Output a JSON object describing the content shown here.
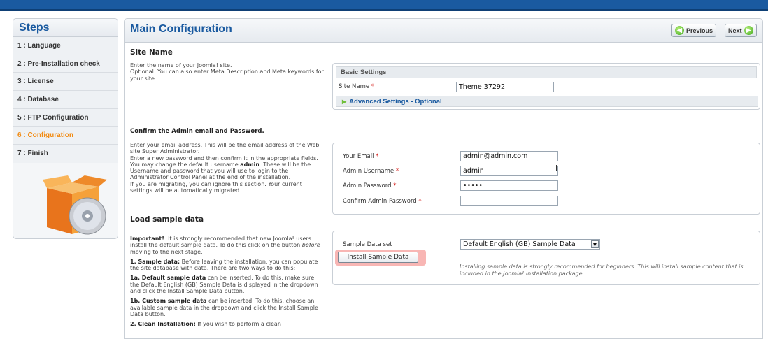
{
  "sidebar": {
    "title": "Steps",
    "steps": [
      {
        "label": "1 : Language"
      },
      {
        "label": "2 : Pre-Installation check"
      },
      {
        "label": "3 : License"
      },
      {
        "label": "4 : Database"
      },
      {
        "label": "5 : FTP Configuration"
      },
      {
        "label": "6 : Configuration"
      },
      {
        "label": "7 : Finish"
      }
    ]
  },
  "header": {
    "title": "Main Configuration",
    "previous_label": "Previous",
    "next_label": "Next"
  },
  "site_name": {
    "section_title": "Site Name",
    "desc_line1": "Enter the name of your Joomla! site.",
    "desc_line2": "Optional: You can also enter Meta Description and Meta keywords for your site.",
    "fieldset_title": "Basic Settings",
    "site_name_label": "Site Name",
    "site_name_value": "Theme 37292",
    "advanced_label": "Advanced Settings - Optional"
  },
  "admin": {
    "section_title": "Confirm the Admin email and Password.",
    "desc_a": "Enter your email address. This will be the email address of the Web site Super Administrator.",
    "desc_b": "Enter a new password and then confirm it in the appropriate fields. You may change the default username",
    "desc_b_bold": "admin",
    "desc_c": ". These will be the Username and password that you will use to login to the Administrator Control Panel at the end of the installation.",
    "desc_d": "If you are migrating, you can ignore this section. Your current settings will be automatically migrated.",
    "email_label": "Your Email",
    "email_value": "admin@admin.com",
    "username_label": "Admin Username",
    "username_value": "admin",
    "password_label": "Admin Password",
    "password_value": "•••••",
    "confirm_label": "Confirm Admin Password",
    "confirm_value": ""
  },
  "sample": {
    "section_title": "Load sample data",
    "important_bold": "Important!",
    "important_text": ": It is strongly recommended that new Joomla! users install the default sample data. To do this click on the button",
    "important_em": "before",
    "important_end": "moving to the next stage.",
    "p1_bold": "1. Sample data:",
    "p1_text": "Before leaving the installation, you can populate the site database with data. There are two ways to do this:",
    "p1a_bold": "1a. Default sample data",
    "p1a_text": "can be inserted. To do this, make sure the Default English (GB) Sample Data is displayed in the dropdown and click the Install Sample Data button.",
    "p1b_bold": "1b. Custom sample data",
    "p1b_text": "can be inserted. To do this, choose an available sample data in the dropdown and click the Install Sample Data button.",
    "p2_bold": "2. Clean Installation:",
    "p2_text": "If you wish to perform a clean",
    "set_label": "Sample Data set",
    "set_value": "Default English (GB) Sample Data",
    "install_label": "Install Sample Data",
    "note": "Installing sample data is strongly recommended for beginners. This will install sample content that is included in the Joomla! installation package."
  },
  "required_mark": "*"
}
